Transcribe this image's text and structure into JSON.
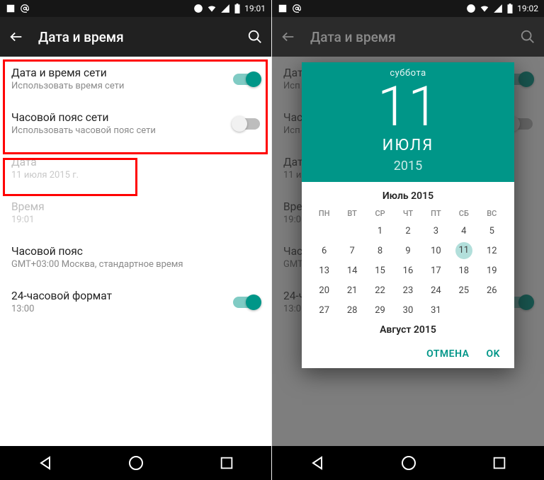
{
  "left": {
    "status_time": "19:01",
    "appbar_title": "Дата и время",
    "rows": {
      "net_date": {
        "title": "Дата и время сети",
        "sub": "Использовать время сети"
      },
      "net_tz": {
        "title": "Часовой пояс сети",
        "sub": "Использовать часовой пояс сети"
      },
      "date": {
        "title": "Дата",
        "sub": "11 июля 2015 г."
      },
      "time": {
        "title": "Время",
        "sub": "19:01"
      },
      "tz": {
        "title": "Часовой пояс",
        "sub": "GMT+03:00 Москва, стандартное время"
      },
      "h24": {
        "title": "24-часовой формат",
        "sub": "13:00"
      }
    }
  },
  "right": {
    "status_time": "19:02",
    "appbar_title": "Дата и время",
    "rows": {
      "net_date": {
        "title": "Дат",
        "sub": "Исп"
      },
      "net_tz": {
        "title": "Час",
        "sub": "Исп"
      },
      "date": {
        "title": "Дат",
        "sub": "11 и"
      },
      "time": {
        "title": "Вре",
        "sub": "19:0"
      },
      "tz": {
        "title": "Час",
        "sub": "GMT"
      },
      "h24": {
        "title": "24-ч",
        "sub": "13:0"
      }
    },
    "picker": {
      "dow": "суббота",
      "day": "11",
      "month": "ИЮЛЯ",
      "year": "2015",
      "month1_label": "Июль 2015",
      "month2_label": "Август 2015",
      "weekdays": [
        "ПН",
        "ВТ",
        "СР",
        "ЧТ",
        "ПТ",
        "СБ",
        "ВС"
      ],
      "actions": {
        "cancel": "ОТМЕНА",
        "ok": "OK"
      }
    }
  }
}
